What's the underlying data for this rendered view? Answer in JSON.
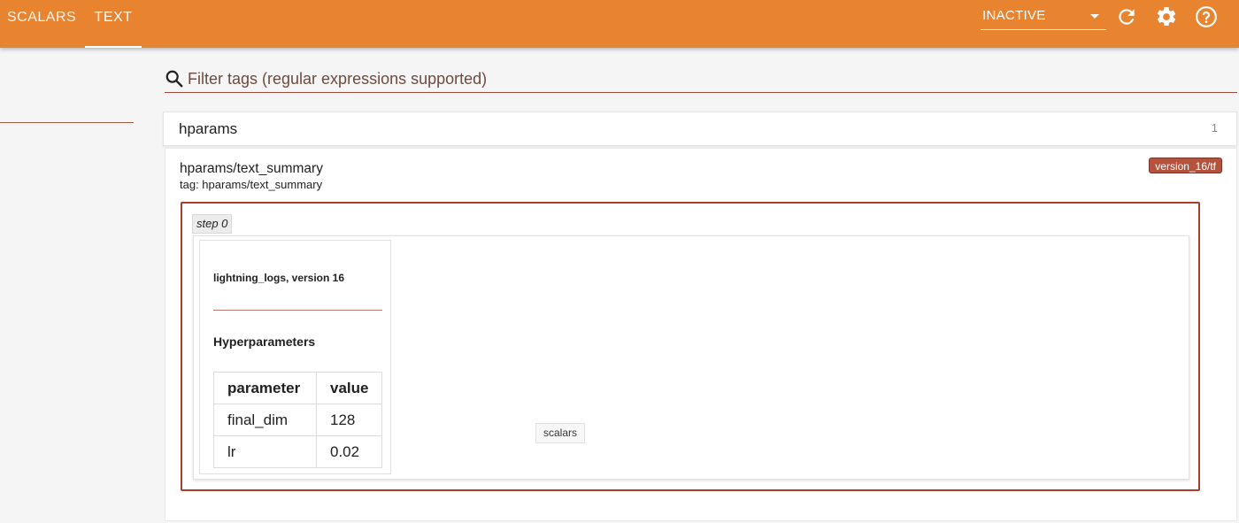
{
  "topbar": {
    "tabs": [
      {
        "label": "SCALARS",
        "active": false
      },
      {
        "label": "TEXT",
        "active": true
      }
    ],
    "run_status": "INACTIVE",
    "icons": [
      "refresh-icon",
      "gear-icon",
      "help-icon"
    ],
    "accent_color": "#e8832f"
  },
  "filter": {
    "placeholder": "Filter tags (regular expressions supported)",
    "value": ""
  },
  "category": {
    "name": "hparams",
    "count": "1"
  },
  "card": {
    "title": "hparams/text_summary",
    "tag": "tag: hparams/text_summary",
    "run": "version_16/tf",
    "step": "step 0",
    "summary": {
      "header": "lightning_logs, version 16",
      "section": "Hyperparameters",
      "columns": [
        "parameter",
        "value"
      ],
      "rows": [
        [
          "final_dim",
          "128"
        ],
        [
          "lr",
          "0.02"
        ]
      ]
    }
  },
  "tooltip": "scalars"
}
